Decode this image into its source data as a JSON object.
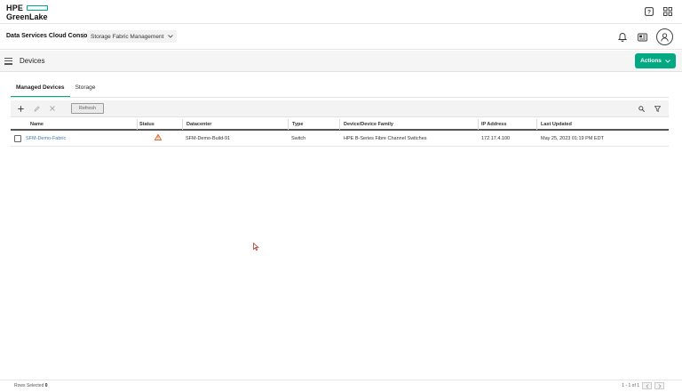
{
  "brand": {
    "line1": "HPE",
    "line2": "GreenLake",
    "accent": "#01a982"
  },
  "top_icons": [
    "help-icon",
    "app-grid-icon"
  ],
  "console": {
    "title": "Data Services Cloud Console",
    "separator": "|",
    "service": "Storage Fabric Management",
    "icons": [
      "bell-icon",
      "news-icon",
      "user-avatar-icon"
    ]
  },
  "page": {
    "title": "Devices",
    "actions_label": "Actions"
  },
  "tabs": [
    {
      "label": "Managed Devices",
      "active": true
    },
    {
      "label": "Storage",
      "active": false
    }
  ],
  "toolbar": {
    "refresh_label": "Refresh",
    "icons": [
      "add-icon",
      "edit-icon",
      "delete-icon",
      "search-icon",
      "filter-icon"
    ]
  },
  "table": {
    "columns": [
      "Name",
      "Status",
      "Datacenter",
      "Type",
      "Device/Device Family",
      "IP Address",
      "Last Updated"
    ],
    "rows": [
      {
        "name": "SFM-Demo-Fabric",
        "status": "warning",
        "datacenter": "SFM-Demo-Build-91",
        "type": "Switch",
        "family": "HPE B-Series Fibre Channel Switches",
        "ip": "172.17.4.100",
        "updated": "May 25, 2023 01:19 PM EDT"
      }
    ]
  },
  "footer": {
    "rows_selected_label": "Rows Selected",
    "rows_selected_count": "0",
    "pagination": "1 - 1 of 1"
  },
  "colors": {
    "warning": "#e05a1e",
    "link": "#3a7db5"
  }
}
